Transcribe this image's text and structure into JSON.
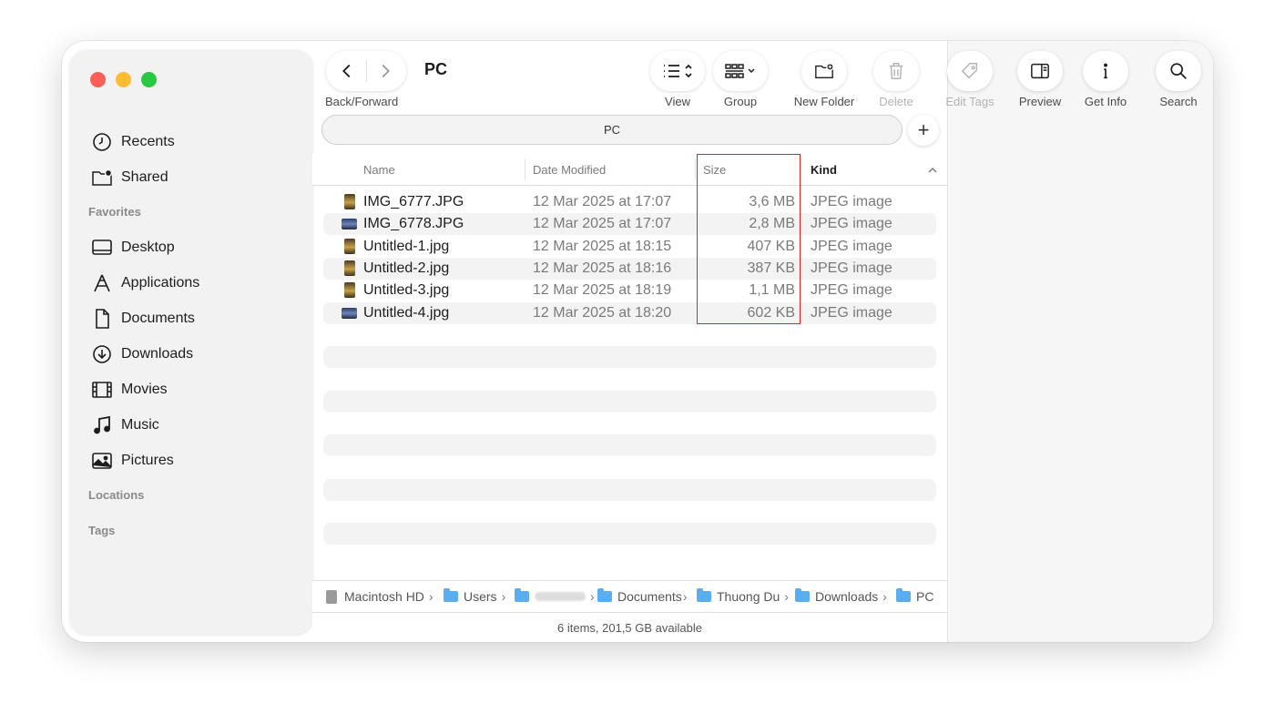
{
  "window": {
    "title": "PC",
    "traffic_lights": [
      "#fe5f57",
      "#febc2e",
      "#28c840"
    ]
  },
  "sidebar": {
    "top_items": [
      {
        "label": "Recents",
        "icon": "clock-icon"
      },
      {
        "label": "Shared",
        "icon": "shared-folder-icon"
      }
    ],
    "favorites_header": "Favorites",
    "favorites": [
      {
        "label": "Desktop",
        "icon": "desktop-icon"
      },
      {
        "label": "Applications",
        "icon": "applications-icon"
      },
      {
        "label": "Documents",
        "icon": "document-icon"
      },
      {
        "label": "Downloads",
        "icon": "download-icon"
      },
      {
        "label": "Movies",
        "icon": "film-icon"
      },
      {
        "label": "Music",
        "icon": "music-note-icon"
      },
      {
        "label": "Pictures",
        "icon": "picture-icon"
      }
    ],
    "locations_header": "Locations",
    "tags_header": "Tags"
  },
  "toolbar": {
    "back_forward_label": "Back/Forward",
    "view_label": "View",
    "group_label": "Group",
    "new_folder_label": "New Folder",
    "delete_label": "Delete",
    "edit_tags_label": "Edit Tags",
    "preview_label": "Preview",
    "get_info_label": "Get Info",
    "search_label": "Search"
  },
  "tab_bar": {
    "active_tab": "PC",
    "add_label": "+"
  },
  "columns": {
    "name": "Name",
    "date_modified": "Date Modified",
    "size": "Size",
    "kind": "Kind",
    "sorted_by": "Kind"
  },
  "files": [
    {
      "name": "IMG_6777.JPG",
      "date": "12 Mar 2025 at 17:07",
      "size": "3,6 MB",
      "kind": "JPEG image",
      "thumb": "portrait"
    },
    {
      "name": "IMG_6778.JPG",
      "date": "12 Mar 2025 at 17:07",
      "size": "2,8 MB",
      "kind": "JPEG image",
      "thumb": "landscape"
    },
    {
      "name": "Untitled-1.jpg",
      "date": "12 Mar 2025 at 18:15",
      "size": "407 KB",
      "kind": "JPEG image",
      "thumb": "portrait"
    },
    {
      "name": "Untitled-2.jpg",
      "date": "12 Mar 2025 at 18:16",
      "size": "387 KB",
      "kind": "JPEG image",
      "thumb": "portrait"
    },
    {
      "name": "Untitled-3.jpg",
      "date": "12 Mar 2025 at 18:19",
      "size": "1,1 MB",
      "kind": "JPEG image",
      "thumb": "portrait"
    },
    {
      "name": "Untitled-4.jpg",
      "date": "12 Mar 2025 at 18:20",
      "size": "602 KB",
      "kind": "JPEG image",
      "thumb": "landscape"
    }
  ],
  "path_bar": {
    "crumbs": [
      "Macintosh HD",
      "Users",
      "",
      "Documents",
      "Thuong Du",
      "Downloads",
      "PC"
    ]
  },
  "status": {
    "text": "6 items, 201,5 GB available"
  },
  "highlight": {
    "color": "#e02424",
    "target_column": "Size"
  }
}
